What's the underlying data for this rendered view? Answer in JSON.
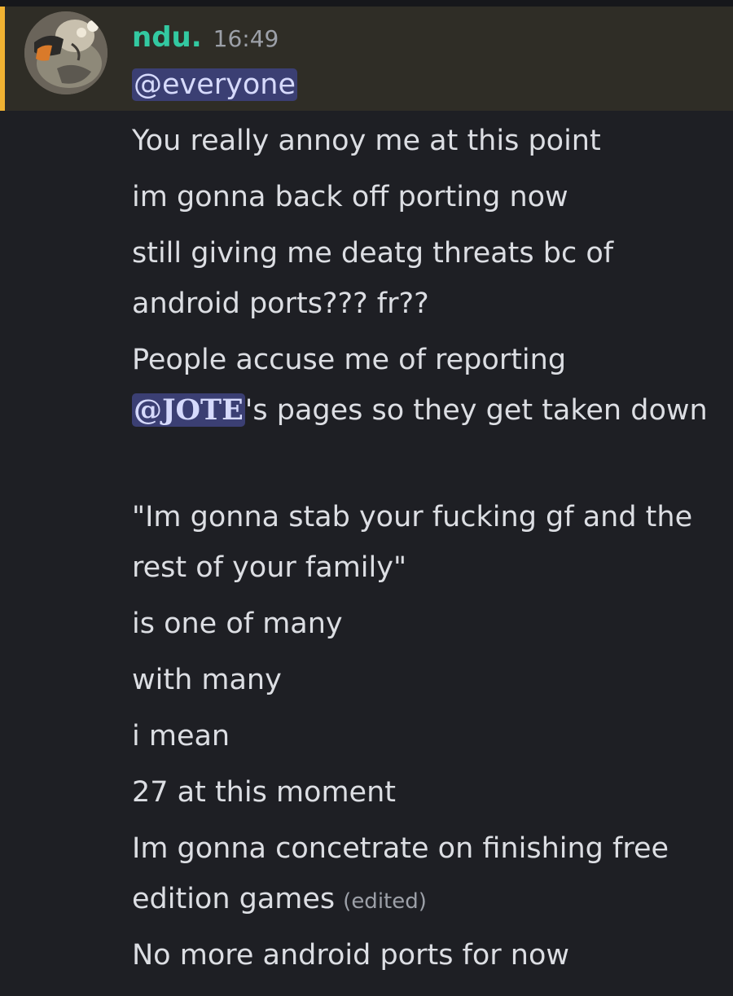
{
  "message": {
    "author": "ndu.",
    "time": "16:49",
    "lines": [
      {
        "mention": "@everyone"
      },
      {
        "text": "You really annoy me at this point"
      },
      {
        "text": "im gonna back off porting now"
      },
      {
        "text": "still giving me deatg threats bc of android ports??? fr??"
      },
      {
        "text": "People accuse me of reporting",
        "mention": "@JOTE",
        "after": "'s pages so they get taken down"
      },
      {
        "text": "\"Im gonna stab your fucking gf and the rest of your family\""
      },
      {
        "text": "is one of many"
      },
      {
        "text": "with many"
      },
      {
        "text": "i mean"
      },
      {
        "text": "27 at this moment"
      },
      {
        "text": "Im gonna concetrate on finishing free edition games",
        "edited_tag": "(edited)"
      },
      {
        "text": "No more android ports for now"
      }
    ]
  },
  "colors": {
    "background": "#1e1f24",
    "highlight_background": "#2f2d26",
    "highlight_bar": "#f0b232",
    "username": "#33c9a1",
    "mention_background": "#3b3f73"
  },
  "icons": {
    "avatar": "user-avatar"
  }
}
